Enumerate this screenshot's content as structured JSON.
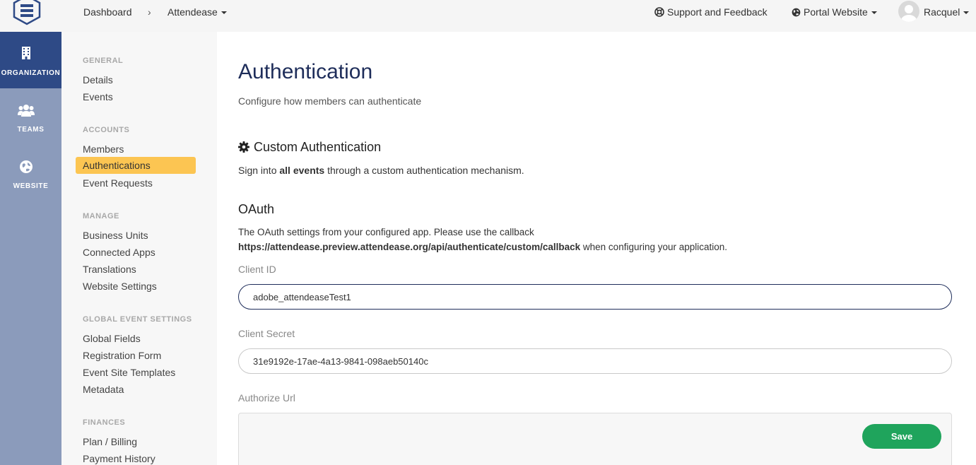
{
  "header": {
    "breadcrumb_dashboard": "Dashboard",
    "breadcrumb_separator": "›",
    "breadcrumb_org": "Attendease",
    "support_label": "Support and Feedback",
    "portal_label": "Portal Website",
    "user_name": "Racquel"
  },
  "rail": {
    "items": [
      {
        "label": "ORGANIZATION",
        "icon": "building-icon"
      },
      {
        "label": "TEAMS",
        "icon": "users-icon"
      },
      {
        "label": "WEBSITE",
        "icon": "globe-icon"
      }
    ]
  },
  "sidebar": {
    "general_title": "GENERAL",
    "general_items": [
      "Details",
      "Events"
    ],
    "accounts_title": "ACCOUNTS",
    "accounts_items": [
      "Members",
      "Authentications",
      "Event Requests"
    ],
    "manage_title": "MANAGE",
    "manage_items": [
      "Business Units",
      "Connected Apps",
      "Translations",
      "Website Settings"
    ],
    "global_title": "GLOBAL EVENT SETTINGS",
    "global_items": [
      "Global Fields",
      "Registration Form",
      "Event Site Templates",
      "Metadata"
    ],
    "finances_title": "FINANCES",
    "finances_items": [
      "Plan / Billing",
      "Payment History"
    ]
  },
  "main": {
    "title": "Authentication",
    "subtitle": "Configure how members can authenticate",
    "custom_auth_title": "Custom Authentication",
    "custom_auth_desc_prefix": "Sign into ",
    "custom_auth_desc_bold": "all events",
    "custom_auth_desc_suffix": " through a custom authentication mechanism.",
    "oauth_title": "OAuth",
    "oauth_desc_line1": "The OAuth settings from your configured app. Please use the callback",
    "oauth_callback_url": "https://attendease.preview.attendease.org/api/authenticate/custom/callback",
    "oauth_desc_line2_suffix": " when configuring your application.",
    "client_id_label": "Client ID",
    "client_id_value": "adobe_attendeaseTest1",
    "client_secret_label": "Client Secret",
    "client_secret_value": "31e9192e-17ae-4a13-9841-098aeb50140c",
    "authorize_url_label": "Authorize Url",
    "save_label": "Save"
  }
}
